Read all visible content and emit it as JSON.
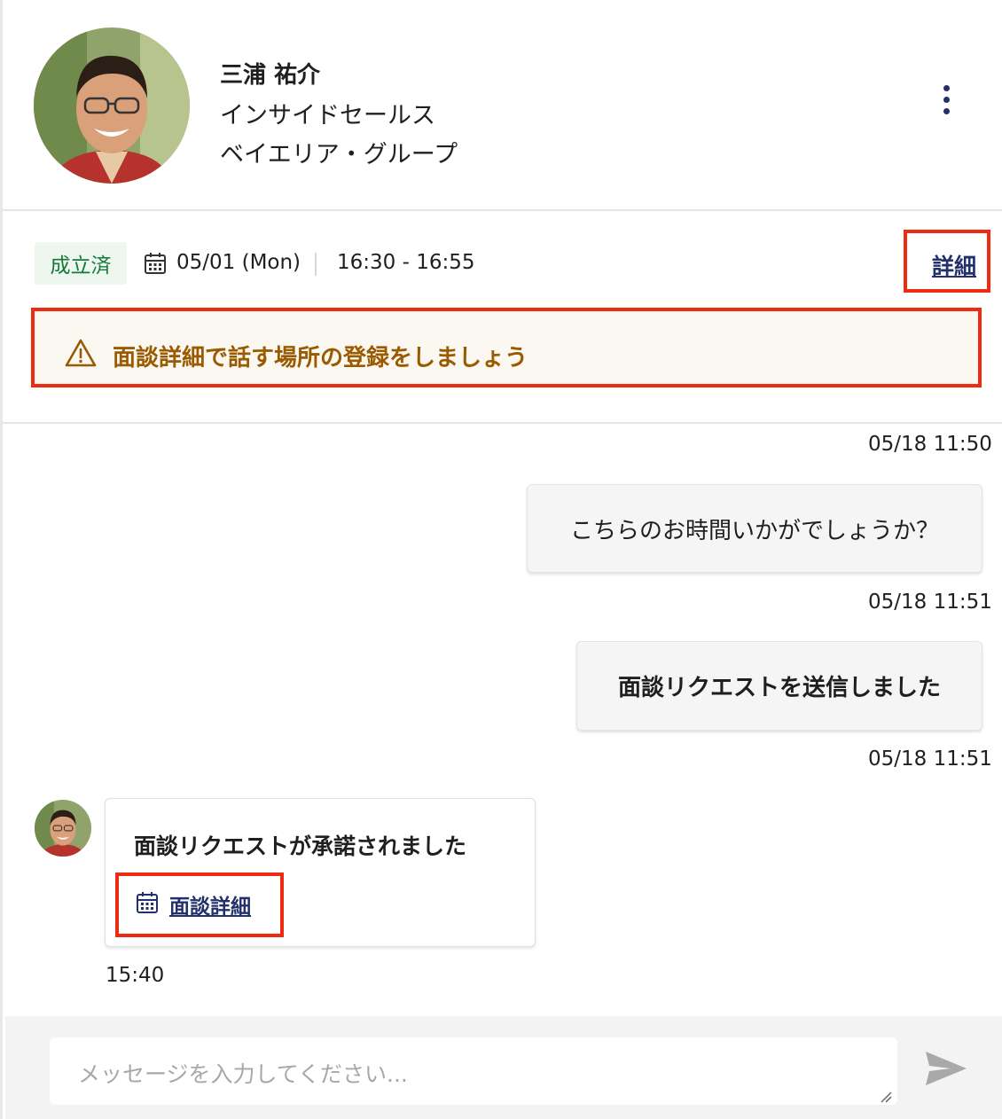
{
  "profile": {
    "name": "三浦 祐介",
    "role": "インサイドセールス",
    "company": "ベイエリア・グループ",
    "avatar_icon": "person-photo",
    "menu_icon": "kebab-vertical-icon"
  },
  "meeting": {
    "status": "成立済",
    "date": "05/01 (Mon)",
    "time": "16:30 - 16:55",
    "detail_link": "詳細",
    "alert": "面談詳細で話す場所の登録をしましょう",
    "colors": {
      "status_bg": "#edf6ef",
      "status_text": "#137a37",
      "alert_text": "#9a5a00",
      "link": "#22316b",
      "highlight": "#ee2a10"
    }
  },
  "messages": {
    "m1": {
      "timestamp": "05/18 11:50",
      "text": "こちらのお時間いかがでしょうか？"
    },
    "m2": {
      "timestamp": "05/18 11:51",
      "text": "面談リクエストを送信しました"
    },
    "m3": {
      "timestamp": "05/18 11:51",
      "title": "面談リクエストが承諾されました",
      "link": "面談詳細",
      "time": "15:40"
    }
  },
  "composer": {
    "placeholder": "メッセージを入力してください...",
    "send_icon": "send-icon"
  }
}
